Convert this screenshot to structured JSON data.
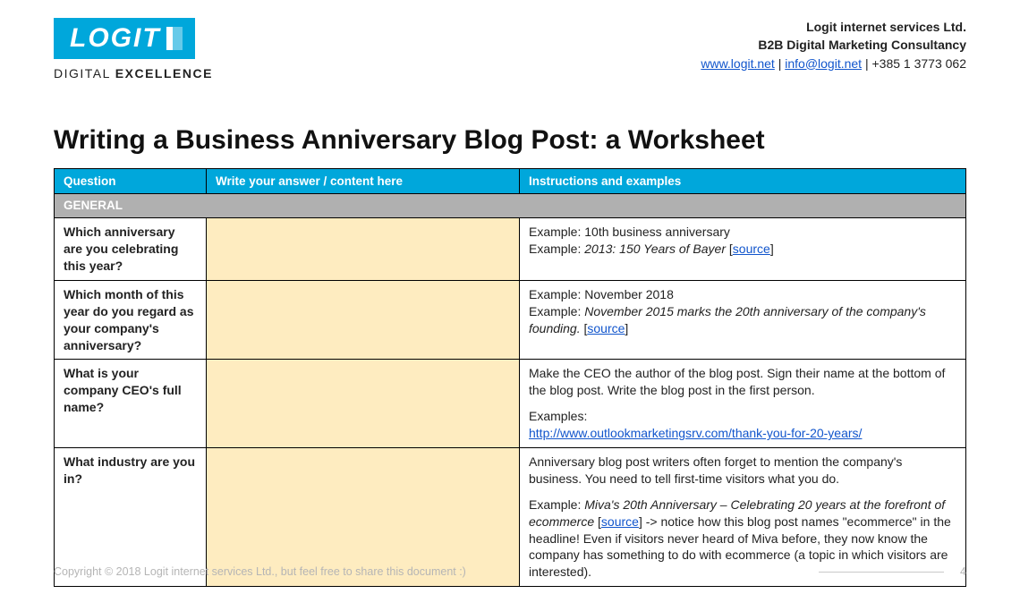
{
  "logo": {
    "word": "LOGIT",
    "tagline_thin": "DIGITAL ",
    "tagline_bold": "EXCELLENCE"
  },
  "company": {
    "name": "Logit internet services Ltd.",
    "desc": "B2B Digital Marketing Consultancy",
    "site": "www.logit.net",
    "sep1": " | ",
    "email": "info@logit.net",
    "sep2": " | ",
    "phone": "+385 1 3773 062"
  },
  "title": "Writing a Business Anniversary Blog Post: a Worksheet",
  "headers": {
    "q": "Question",
    "a": "Write your answer / content here",
    "i": "Instructions and examples"
  },
  "section_general": "GENERAL",
  "rows": {
    "r1": {
      "q": "Which anniversary are you celebrating this year?",
      "i_l1": "Example: 10th business anniversary",
      "i_l2a": "Example: ",
      "i_l2b": "2013: 150 Years of Bayer",
      "i_l2c": " [",
      "i_src": "source",
      "i_l2d": "]"
    },
    "r2": {
      "q": "Which month of this year do you regard as your company's anniversary?",
      "i_l1": "Example: November 2018",
      "i_l2a": "Example: ",
      "i_l2b": "November 2015 marks the 20th anniversary of the company's founding.",
      "i_l2c": " [",
      "i_src": "source",
      "i_l2d": "]"
    },
    "r3": {
      "q": "What is your company CEO's full name?",
      "i_p1": "Make the CEO the author of the blog post. Sign their name at the bottom of the blog post. Write the blog post in the first person.",
      "i_exlabel": "Examples:",
      "i_link": "http://www.outlookmarketingsrv.com/thank-you-for-20-years/"
    },
    "r4": {
      "q": "What industry are you in?",
      "i_p1": "Anniversary blog post writers often forget to mention the company's business. You need to tell first-time visitors what you do.",
      "i_l2a": "Example: ",
      "i_l2b": "Miva's 20th Anniversary – Celebrating 20 years at the forefront of ecommerce",
      "i_l2c": " [",
      "i_src": "source",
      "i_l2d": "] -> notice how this blog post names \"ecommerce\" in the headline! Even if visitors never heard of Miva before, they now know the company has something to do with ecommerce (a topic in which visitors are interested)."
    }
  },
  "footer": {
    "copy": "Copyright © 2018 Logit internet services Ltd., but feel free to share this document :)",
    "page": "4"
  }
}
